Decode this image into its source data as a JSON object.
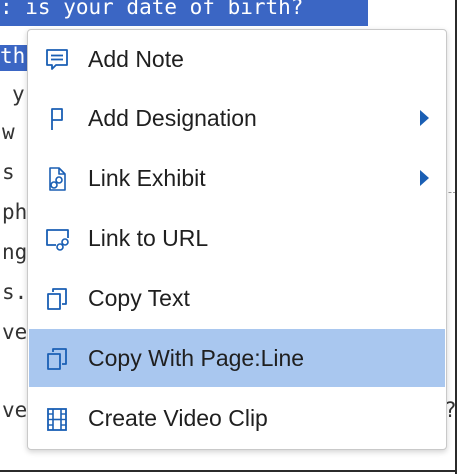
{
  "document": {
    "highlighted_line": ": is your date of birth?",
    "line2_fragment": "th",
    "left_chars": [
      "y",
      "w",
      "s",
      "ph",
      "ng",
      "s.",
      "ve",
      "ve"
    ],
    "right_char": "?"
  },
  "context_menu": {
    "items": [
      {
        "label": "Add Note",
        "icon": "note-icon",
        "has_submenu": false,
        "selected": false
      },
      {
        "label": "Add Designation",
        "icon": "flag-icon",
        "has_submenu": true,
        "selected": false
      },
      {
        "label": "Link Exhibit",
        "icon": "link-exhibit-icon",
        "has_submenu": true,
        "selected": false
      },
      {
        "label": "Link to URL",
        "icon": "link-url-icon",
        "has_submenu": false,
        "selected": false
      },
      {
        "label": "Copy Text",
        "icon": "copy-icon",
        "has_submenu": false,
        "selected": false
      },
      {
        "label": "Copy With Page:Line",
        "icon": "copy-icon",
        "has_submenu": false,
        "selected": true
      },
      {
        "label": "Create Video Clip",
        "icon": "film-icon",
        "has_submenu": false,
        "selected": false
      }
    ]
  },
  "colors": {
    "selection_highlight": "#a9c7ef",
    "text_highlight": "#3b66c4",
    "icon_blue": "#1a5fb4"
  }
}
